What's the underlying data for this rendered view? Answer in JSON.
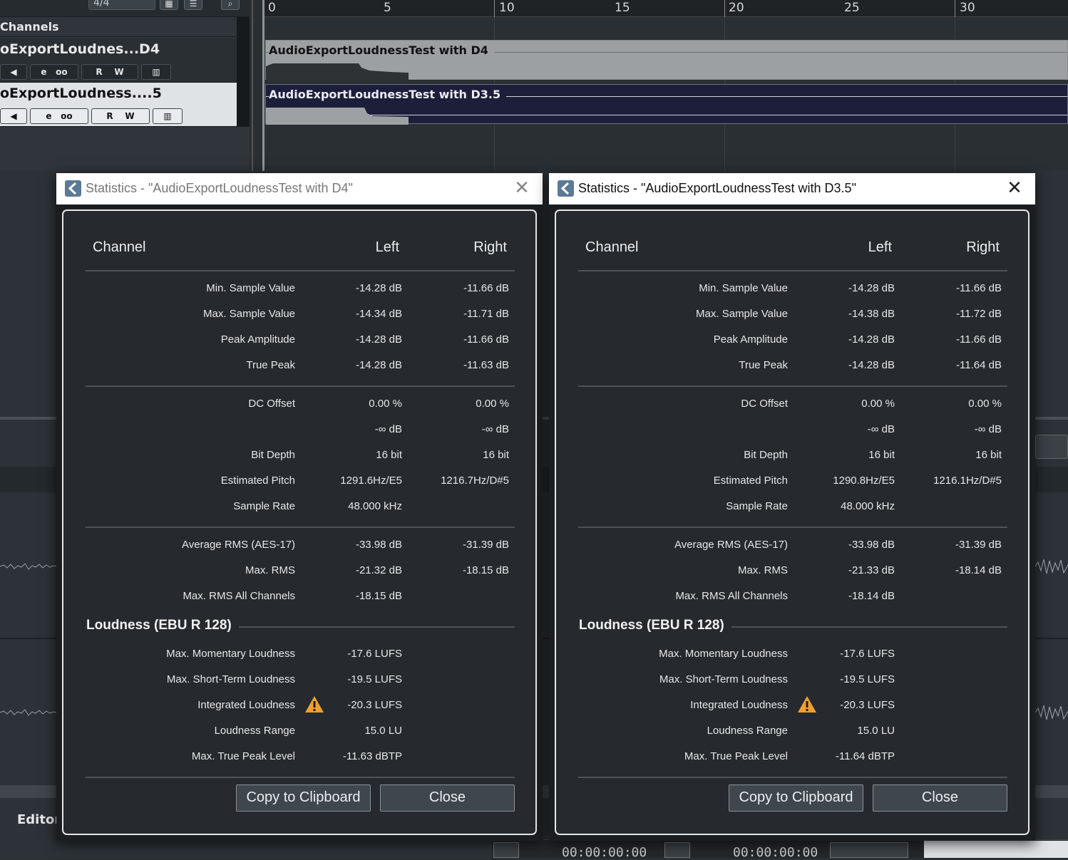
{
  "background": {
    "time_signature": "4/4",
    "channels_header": "Channels",
    "tracks": [
      {
        "name": "oExportLoudnes...D4",
        "selected": false
      },
      {
        "name": "oExportLoudness....5",
        "selected": true
      }
    ],
    "track_buttons": {
      "edit": "e",
      "link": "oo",
      "read": "R",
      "write": "W"
    },
    "ruler_labels": [
      "0",
      "5",
      "10",
      "15",
      "20",
      "25",
      "30"
    ],
    "events": [
      {
        "name": "AudioExportLoudnessTest with D4"
      },
      {
        "name": "AudioExportLoudnessTest with D3.5"
      }
    ],
    "editor_label": "Editor",
    "timecode_1": "00:00:00:00",
    "timecode_2": "00:00:00:00"
  },
  "dialogs": [
    {
      "id": "d4",
      "title": "Statistics - \"AudioExportLoudnessTest with D4\"",
      "active": false,
      "columns": {
        "channel": "Channel",
        "left": "Left",
        "right": "Right"
      },
      "rows_amplitude": [
        {
          "label": "Min. Sample Value",
          "left": "-14.28 dB",
          "right": "-11.66 dB"
        },
        {
          "label": "Max. Sample Value",
          "left": "-14.34 dB",
          "right": "-11.71 dB"
        },
        {
          "label": "Peak Amplitude",
          "left": "-14.28 dB",
          "right": "-11.66 dB"
        },
        {
          "label": "True Peak",
          "left": "-14.28 dB",
          "right": "-11.63 dB"
        }
      ],
      "rows_signal": [
        {
          "label": "DC Offset",
          "left": "0.00 %",
          "right": "0.00 %"
        },
        {
          "label": "",
          "left": "-∞ dB",
          "right": "-∞ dB"
        },
        {
          "label": "Bit Depth",
          "left": "16 bit",
          "right": "16 bit"
        },
        {
          "label": "Estimated Pitch",
          "left": "1291.6Hz/E5",
          "right": "1216.7Hz/D#5"
        },
        {
          "label": "Sample Rate",
          "left": "48.000 kHz",
          "right": ""
        }
      ],
      "rows_rms": [
        {
          "label": "Average RMS (AES-17)",
          "left": "-33.98 dB",
          "right": "-31.39 dB"
        },
        {
          "label": "Max. RMS",
          "left": "-21.32 dB",
          "right": "-18.15 dB"
        },
        {
          "label": "Max. RMS All Channels",
          "left": "-18.15 dB",
          "right": ""
        }
      ],
      "loudness_title": "Loudness (EBU R 128)",
      "rows_loudness": [
        {
          "label": "Max. Momentary Loudness",
          "left": "-17.6 LUFS",
          "warning": false
        },
        {
          "label": "Max. Short-Term Loudness",
          "left": "-19.5 LUFS",
          "warning": false
        },
        {
          "label": "Integrated Loudness",
          "left": "-20.3 LUFS",
          "warning": true
        },
        {
          "label": "Loudness Range",
          "left": "15.0 LU",
          "warning": false
        },
        {
          "label": "Max. True Peak Level",
          "left": "-11.63 dBTP",
          "warning": false
        }
      ],
      "buttons": {
        "copy": "Copy to Clipboard",
        "close": "Close"
      }
    },
    {
      "id": "d35",
      "title": "Statistics - \"AudioExportLoudnessTest with D3.5\"",
      "active": true,
      "columns": {
        "channel": "Channel",
        "left": "Left",
        "right": "Right"
      },
      "rows_amplitude": [
        {
          "label": "Min. Sample Value",
          "left": "-14.28 dB",
          "right": "-11.66 dB"
        },
        {
          "label": "Max. Sample Value",
          "left": "-14.38 dB",
          "right": "-11.72 dB"
        },
        {
          "label": "Peak Amplitude",
          "left": "-14.28 dB",
          "right": "-11.66 dB"
        },
        {
          "label": "True Peak",
          "left": "-14.28 dB",
          "right": "-11.64 dB"
        }
      ],
      "rows_signal": [
        {
          "label": "DC Offset",
          "left": "0.00 %",
          "right": "0.00 %"
        },
        {
          "label": "",
          "left": "-∞ dB",
          "right": "-∞ dB"
        },
        {
          "label": "Bit Depth",
          "left": "16 bit",
          "right": "16 bit"
        },
        {
          "label": "Estimated Pitch",
          "left": "1290.8Hz/E5",
          "right": "1216.1Hz/D#5"
        },
        {
          "label": "Sample Rate",
          "left": "48.000 kHz",
          "right": ""
        }
      ],
      "rows_rms": [
        {
          "label": "Average RMS (AES-17)",
          "left": "-33.98 dB",
          "right": "-31.39 dB"
        },
        {
          "label": "Max. RMS",
          "left": "-21.33 dB",
          "right": "-18.14 dB"
        },
        {
          "label": "Max. RMS All Channels",
          "left": "-18.14 dB",
          "right": ""
        }
      ],
      "loudness_title": "Loudness (EBU R 128)",
      "rows_loudness": [
        {
          "label": "Max. Momentary Loudness",
          "left": "-17.6 LUFS",
          "warning": false
        },
        {
          "label": "Max. Short-Term Loudness",
          "left": "-19.5 LUFS",
          "warning": false
        },
        {
          "label": "Integrated Loudness",
          "left": "-20.3 LUFS",
          "warning": true
        },
        {
          "label": "Loudness Range",
          "left": "15.0 LU",
          "warning": false
        },
        {
          "label": "Max. True Peak Level",
          "left": "-11.64 dBTP",
          "warning": false
        }
      ],
      "buttons": {
        "copy": "Copy to Clipboard",
        "close": "Close"
      }
    }
  ]
}
